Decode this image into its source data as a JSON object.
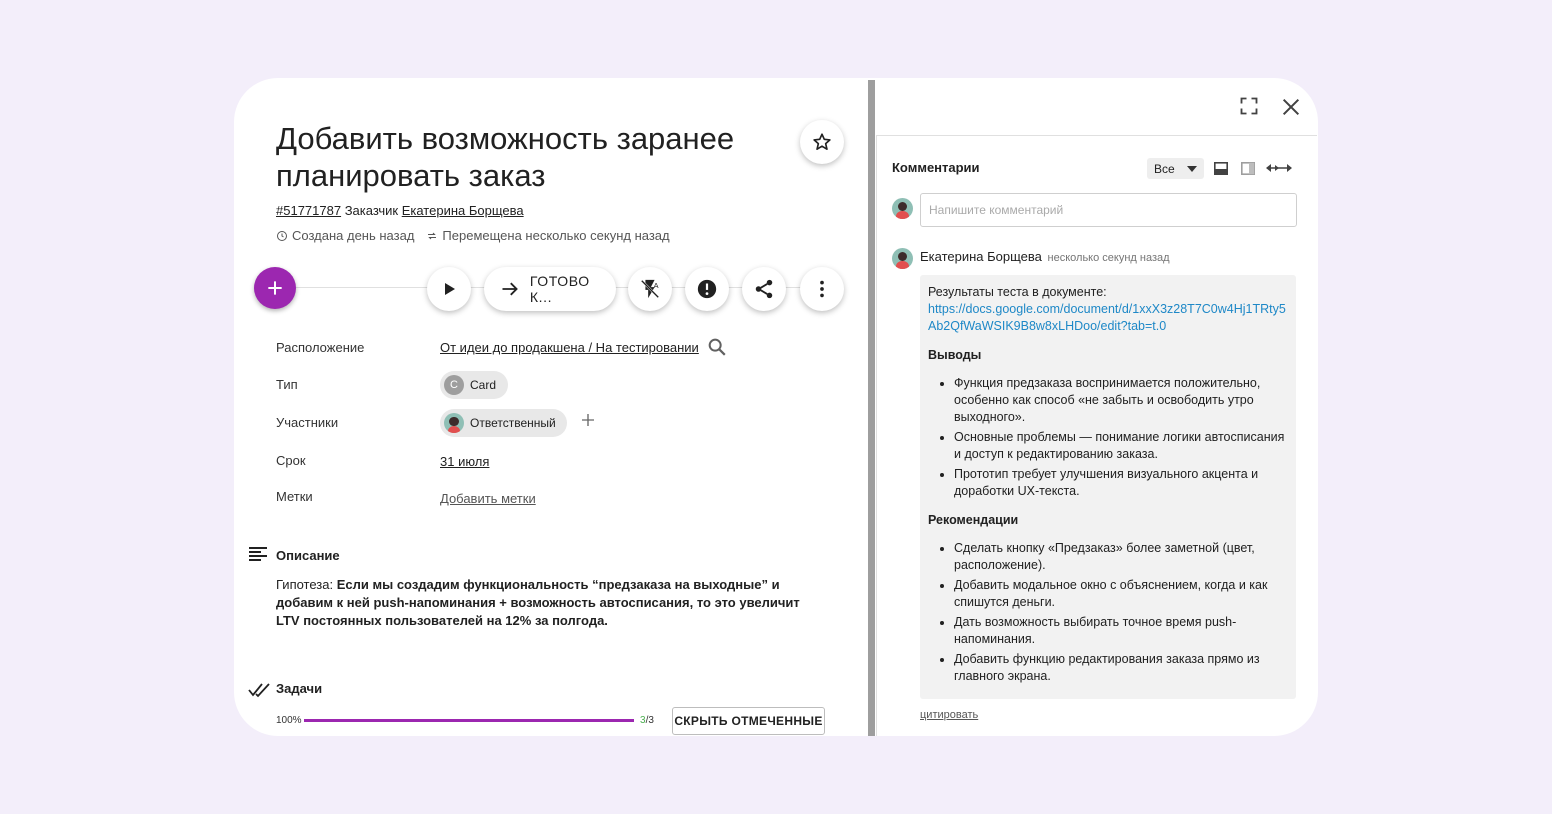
{
  "task": {
    "title": "Добавить возможность заранее планировать заказ",
    "id_link": "#51771787",
    "customer_label": "Заказчик",
    "customer_name": "Екатерина Борщева",
    "created": "Создана день назад",
    "moved": "Перемещена несколько секунд назад"
  },
  "toolbar": {
    "add_icon": "plus-icon",
    "play_icon": "play-icon",
    "move_label": "ГОТОВО К...",
    "flash_icon": "flash-off-icon",
    "priority_icon": "priority-icon",
    "share_icon": "share-icon",
    "more_icon": "more-vert-icon",
    "accent_color": "#9c27b0"
  },
  "fields": {
    "location_label": "Расположение",
    "location_value": "От идеи до продакшена / На тестировании",
    "type_label": "Тип",
    "type_letter": "C",
    "type_value": "Card",
    "members_label": "Участники",
    "members_value": "Ответственный",
    "due_label": "Срок",
    "due_value": "31 июля",
    "tags_label": "Метки",
    "tags_value": "Добавить метки"
  },
  "description": {
    "heading": "Описание",
    "prefix": "Гипотеза: ",
    "bold_text": "Если мы создадим функциональность “предзаказа на выходные” и добавим к ней push-напоминания + возможность автосписания, то это увеличит LTV постоянных пользователей на 12% за полгода."
  },
  "checklist": {
    "heading": "Задачи",
    "percent_label": "100%",
    "progress": 1.0,
    "done": "3",
    "total": "/3",
    "hide_button": "СКРЫТЬ ОТМЕЧЕННЫЕ"
  },
  "comments": {
    "title": "Комментарии",
    "filter_value": "Все",
    "input_placeholder": "Напишите комментарий",
    "author": "Екатерина Борщева",
    "time": "несколько секунд назад",
    "intro": "Результаты теста в документе:",
    "link": "https://docs.google.com/document/d/1xxX3z28T7C0w4Hj1TRty5Ab2QfWaWSIK9B8w8xLHDoo/edit?tab=t.0",
    "conclusions_heading": "Выводы",
    "conclusions": [
      "Функция предзаказа воспринимается положительно, особенно как способ «не забыть и освободить утро выходного».",
      "Основные проблемы — понимание логики автосписания и доступ к редактированию заказа.",
      "Прототип требует улучшения визуального акцента и доработки UX-текста."
    ],
    "recommendations_heading": "Рекомендации",
    "recommendations": [
      "Сделать кнопку «Предзаказ» более заметной (цвет, расположение).",
      "Добавить модальное окно с объяснением, когда и как спишутся деньги.",
      "Дать возможность выбирать точное время push-напоминания.",
      "Добавить функцию редактирования заказа прямо из главного экрана."
    ],
    "quote_label": "цитировать"
  }
}
